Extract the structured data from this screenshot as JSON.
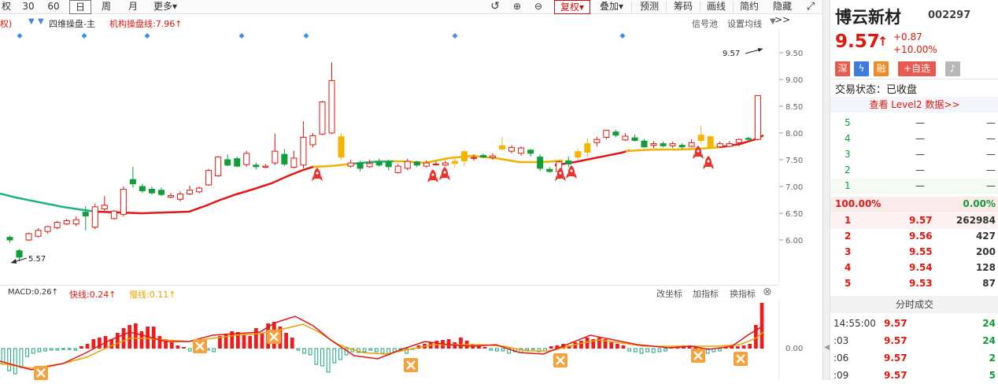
{
  "toolbar": {
    "partial_left": "权",
    "btn_30": "30",
    "btn_60": "60",
    "btn_day": "日",
    "btn_week": "周",
    "btn_month": "月",
    "btn_more": "更多",
    "btn_fuquan": "复权",
    "btn_overlay": "叠加",
    "btn_forecast": "预测",
    "btn_chips": "筹码",
    "btn_draw": "画线",
    "btn_simple": "简约",
    "btn_hide": "隐藏>>"
  },
  "indicator_bar": {
    "partial_left": "权)",
    "series_a": "四维操盘-主",
    "series_b": "机构操盘线:7.96↑",
    "signal_pool": "信号池",
    "set_ma": "设置均线"
  },
  "price_axis": {
    "ticks": [
      "9.50",
      "9.00",
      "8.50",
      "8.00",
      "7.50",
      "7.00",
      "6.50",
      "6.00"
    ],
    "high_label": "9.57",
    "low_label": "5.57"
  },
  "macd_bar": {
    "macd": "MACD:0.26↑",
    "fast": "快线:0.24↑",
    "slow": "慢线:0.11↑",
    "change_coord": "改坐标",
    "add_indicator": "加指标",
    "switch_indicator": "换指标",
    "zero_label": "0.00"
  },
  "stock": {
    "name": "博云新材",
    "code": "002297",
    "price": "9.57",
    "arrow": "↑",
    "change": "+0.87",
    "change_pct": "+10.00%",
    "tag_sz": "深",
    "tag_margin": "融",
    "add_watch": "+自选",
    "trade_status": "交易状态：已收盘",
    "level2": "查看 Level2 数据>>",
    "colors": {
      "up": "#e0190f",
      "down": "#109d3a"
    }
  },
  "order_book": {
    "sell": [
      {
        "level": "5",
        "price": "—",
        "vol": "—"
      },
      {
        "level": "4",
        "price": "—",
        "vol": "—"
      },
      {
        "level": "3",
        "price": "—",
        "vol": "—"
      },
      {
        "level": "2",
        "price": "—",
        "vol": "—"
      },
      {
        "level": "1",
        "price": "—",
        "vol": "—"
      }
    ],
    "ratio_left": "100.00%",
    "ratio_right": "0.00%",
    "buy": [
      {
        "level": "1",
        "price": "9.57",
        "vol": "262984"
      },
      {
        "level": "2",
        "price": "9.56",
        "vol": "427"
      },
      {
        "level": "3",
        "price": "9.55",
        "vol": "200"
      },
      {
        "level": "4",
        "price": "9.54",
        "vol": "128"
      },
      {
        "level": "5",
        "price": "9.53",
        "vol": "87"
      }
    ]
  },
  "trades": {
    "title": "分时成交",
    "rows": [
      {
        "time": "14:55:00",
        "price": "9.57",
        "vol": "24"
      },
      {
        "time": ":03",
        "price": "9.57",
        "vol": "24"
      },
      {
        "time": ":06",
        "price": "9.57",
        "vol": "2"
      },
      {
        "time": ":09",
        "price": "9.57",
        "vol": "5"
      }
    ]
  }
}
